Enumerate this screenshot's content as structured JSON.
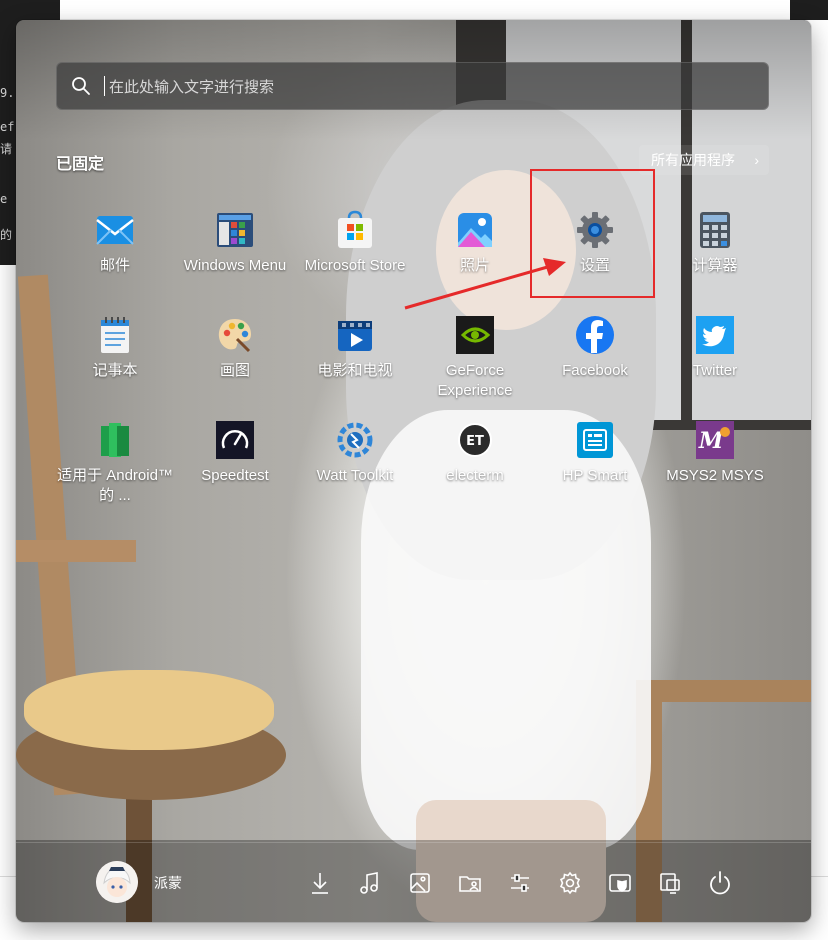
{
  "background_terminal": {
    "lines": [
      "9.",
      "ef",
      "请",
      "e",
      "的"
    ]
  },
  "search": {
    "placeholder": "在此处输入文字进行搜索"
  },
  "pinned": {
    "title": "已固定",
    "all_apps_label": "所有应用程序",
    "all_apps_chevron": "›"
  },
  "apps": [
    {
      "label": "邮件",
      "icon": "mail-icon"
    },
    {
      "label": "Windows Menu",
      "icon": "windows-menu-icon"
    },
    {
      "label": "Microsoft Store",
      "icon": "microsoft-store-icon"
    },
    {
      "label": "照片",
      "icon": "photos-icon"
    },
    {
      "label": "设置",
      "icon": "settings-gear-icon"
    },
    {
      "label": "计算器",
      "icon": "calculator-icon"
    },
    {
      "label": "记事本",
      "icon": "notepad-icon"
    },
    {
      "label": "画图",
      "icon": "paint-palette-icon"
    },
    {
      "label": "电影和电视",
      "icon": "movies-tv-icon"
    },
    {
      "label": "GeForce Experience",
      "icon": "nvidia-geforce-icon"
    },
    {
      "label": "Facebook",
      "icon": "facebook-icon"
    },
    {
      "label": "Twitter",
      "icon": "twitter-icon"
    },
    {
      "label": "适用于 Android™ 的 ...",
      "icon": "android-subsystem-icon"
    },
    {
      "label": "Speedtest",
      "icon": "speedtest-gauge-icon"
    },
    {
      "label": "Watt Toolkit",
      "icon": "watt-toolkit-icon"
    },
    {
      "label": "electerm",
      "icon": "electerm-icon"
    },
    {
      "label": "HP Smart",
      "icon": "hp-smart-icon"
    },
    {
      "label": "MSYS2 MSYS",
      "icon": "msys2-icon"
    }
  ],
  "colors": {
    "highlight": "#e52a2a",
    "mail_blue": "#1a8fe3",
    "facebook_blue": "#1877f2",
    "twitter_blue": "#1da1f2",
    "nvidia_green": "#76b900",
    "msys_purple": "#7a3a8c"
  },
  "user": {
    "name": "派蒙"
  },
  "footer_buttons": [
    "download-icon",
    "music-icon",
    "pictures-icon",
    "user-folder-icon",
    "sliders-icon",
    "settings-gear-icon",
    "security-shield-icon",
    "file-explorer-icon",
    "power-icon"
  ]
}
